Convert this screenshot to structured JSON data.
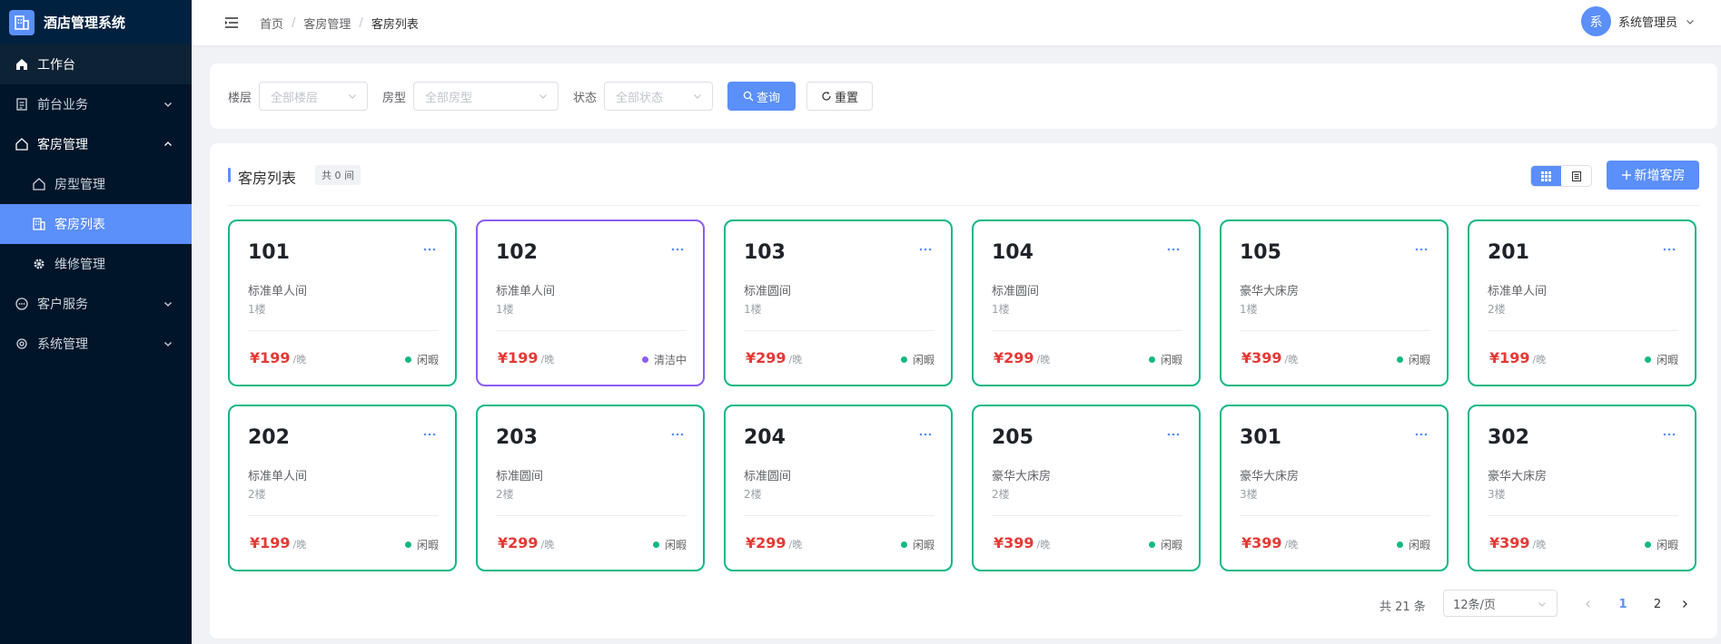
{
  "app": {
    "title": "酒店管理系统",
    "logo_icon": "building-icon",
    "accent": "#5b8ff9"
  },
  "sidebar": {
    "items": [
      {
        "label": "工作台",
        "icon": "home-icon"
      },
      {
        "label": "前台业务",
        "icon": "document-icon"
      },
      {
        "label": "客房管理",
        "icon": "house-icon"
      },
      {
        "label": "房型管理",
        "icon": "house-icon"
      },
      {
        "label": "客房列表",
        "icon": "building-icon"
      },
      {
        "label": "维修管理",
        "icon": "gear-icon"
      },
      {
        "label": "客户服务",
        "icon": "chat-icon"
      },
      {
        "label": "系统管理",
        "icon": "gear-icon"
      }
    ]
  },
  "header": {
    "breadcrumb": [
      "首页",
      "客房管理",
      "客房列表"
    ],
    "breadcrumb_sep": "/",
    "avatar_text": "系",
    "username": "系统管理员"
  },
  "filter": {
    "floor_label": "楼层",
    "floor_placeholder": "全部楼层",
    "type_label": "房型",
    "type_placeholder": "全部房型",
    "status_label": "状态",
    "status_placeholder": "全部状态",
    "query_label": "查询",
    "reset_label": "重置"
  },
  "rooms_panel": {
    "title": "客房列表",
    "count": "共 0 间",
    "add_label": "新增客房",
    "view_mode": "grid"
  },
  "rooms": [
    {
      "number": "101",
      "type": "标准单人间",
      "floor": "1楼",
      "price": "¥199",
      "unit": "/晚",
      "status": "闲暇"
    },
    {
      "number": "102",
      "type": "标准单人间",
      "floor": "1楼",
      "price": "¥199",
      "unit": "/晚",
      "status": "清洁中"
    },
    {
      "number": "103",
      "type": "标准圆间",
      "floor": "1楼",
      "price": "¥299",
      "unit": "/晚",
      "status": "闲暇"
    },
    {
      "number": "104",
      "type": "标准圆间",
      "floor": "1楼",
      "price": "¥299",
      "unit": "/晚",
      "status": "闲暇"
    },
    {
      "number": "105",
      "type": "豪华大床房",
      "floor": "1楼",
      "price": "¥399",
      "unit": "/晚",
      "status": "闲暇"
    },
    {
      "number": "201",
      "type": "标准单人间",
      "floor": "2楼",
      "price": "¥199",
      "unit": "/晚",
      "status": "闲暇"
    },
    {
      "number": "202",
      "type": "标准单人间",
      "floor": "2楼",
      "price": "¥199",
      "unit": "/晚",
      "status": "闲暇"
    },
    {
      "number": "203",
      "type": "标准圆间",
      "floor": "2楼",
      "price": "¥299",
      "unit": "/晚",
      "status": "闲暇"
    },
    {
      "number": "204",
      "type": "标准圆间",
      "floor": "2楼",
      "price": "¥299",
      "unit": "/晚",
      "status": "闲暇"
    },
    {
      "number": "205",
      "type": "豪华大床房",
      "floor": "2楼",
      "price": "¥399",
      "unit": "/晚",
      "status": "闲暇"
    },
    {
      "number": "301",
      "type": "豪华大床房",
      "floor": "3楼",
      "price": "¥399",
      "unit": "/晚",
      "status": "闲暇"
    },
    {
      "number": "302",
      "type": "豪华大床房",
      "floor": "3楼",
      "price": "¥399",
      "unit": "/晚",
      "status": "闲暇"
    }
  ],
  "status_colors": {
    "闲暇": "#10b981",
    "清洁中": "#8b5cf6"
  },
  "pagination": {
    "total": "共 21 条",
    "page_size": "12条/页",
    "pages": [
      "1",
      "2"
    ],
    "current": "1"
  }
}
